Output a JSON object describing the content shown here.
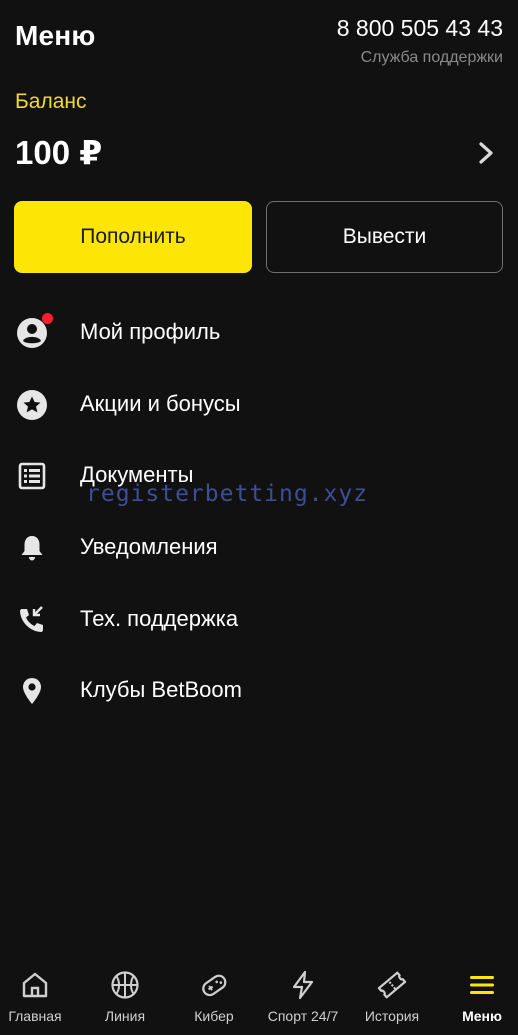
{
  "header": {
    "title": "Меню",
    "phone": "8 800 505 43 43",
    "support_label": "Служба поддержки"
  },
  "balance": {
    "label": "Баланс",
    "amount": "100 ₽"
  },
  "buttons": {
    "topup": "Пополнить",
    "withdraw": "Вывести"
  },
  "menu": [
    {
      "label": "Мой профиль",
      "icon": "profile-icon"
    },
    {
      "label": "Акции и бонусы",
      "icon": "star-icon"
    },
    {
      "label": "Документы",
      "icon": "document-list-icon"
    },
    {
      "label": "Уведомления",
      "icon": "bell-icon"
    },
    {
      "label": "Тех. поддержка",
      "icon": "phone-support-icon"
    },
    {
      "label": "Клубы BetBoom",
      "icon": "location-pin-icon"
    }
  ],
  "watermark": "registerbetting.xyz",
  "bottom_nav": [
    {
      "label": "Главная",
      "icon": "home-icon"
    },
    {
      "label": "Линия",
      "icon": "basketball-icon"
    },
    {
      "label": "Кибер",
      "icon": "gamepad-icon"
    },
    {
      "label": "Спорт 24/7",
      "icon": "lightning-icon"
    },
    {
      "label": "История",
      "icon": "ticket-icon"
    },
    {
      "label": "Меню",
      "icon": "hamburger-menu-icon"
    }
  ],
  "colors": {
    "accent": "#fde606",
    "balance_label": "#f2da33",
    "notification_dot": "#ff1f2d",
    "background": "#111111"
  }
}
